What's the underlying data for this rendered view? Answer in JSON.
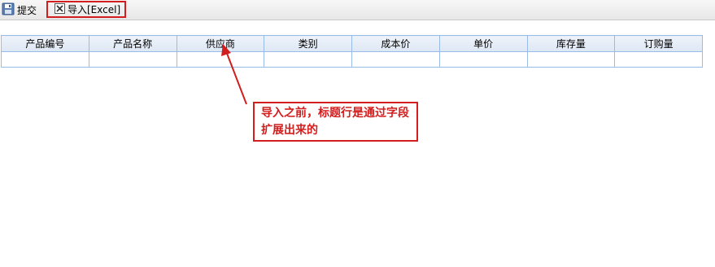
{
  "toolbar": {
    "submit_label": "提交",
    "import_label": "导入[Excel]"
  },
  "grid": {
    "columns": [
      "产品编号",
      "产品名称",
      "供应商",
      "类别",
      "成本价",
      "单价",
      "库存量",
      "订购量"
    ],
    "rows": [
      [
        "",
        "",
        "",
        "",
        "",
        "",
        "",
        ""
      ]
    ]
  },
  "annotation": {
    "text": "导入之前，标题行是通过字段扩展出来的",
    "color": "#d21e1e"
  }
}
